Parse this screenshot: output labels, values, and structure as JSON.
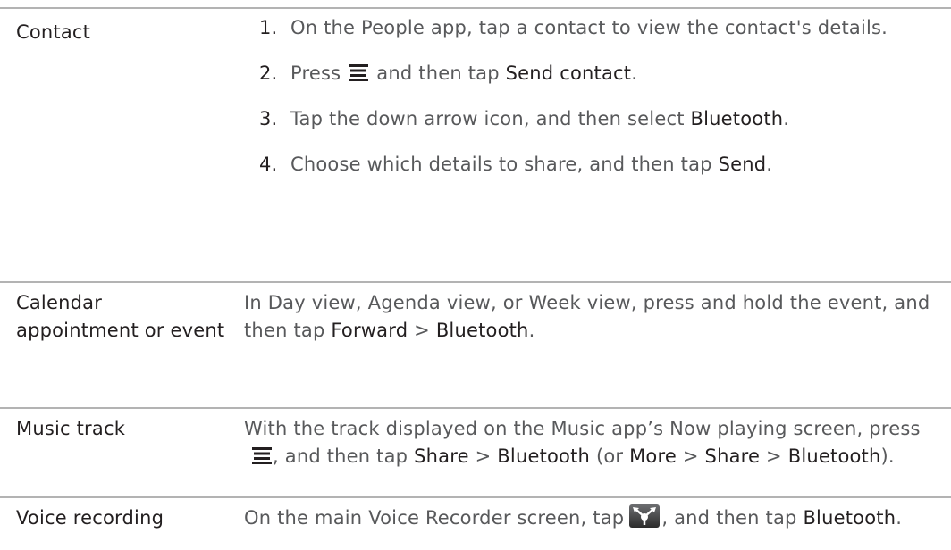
{
  "rows": [
    {
      "label": "Contact",
      "steps": [
        {
          "num": "1.",
          "text": "On the People app, tap a contact to view the contact's details."
        },
        {
          "num": "2.",
          "pre": "Press",
          "mid": "and then tap",
          "em": "Send contact",
          "post": "."
        },
        {
          "num": "3.",
          "pre": "Tap the down arrow icon, and then select",
          "em": "Bluetooth",
          "post": "."
        },
        {
          "num": "4.",
          "pre": "Choose which details to share, and then tap",
          "em": "Send",
          "post": "."
        }
      ]
    },
    {
      "label": "Calendar appointment or event",
      "text_pre": "In Day view, Agenda view, or Week view, press and hold the event, and then tap",
      "em1": "Forward",
      "sep": ">",
      "em2": "Bluetooth",
      "post": "."
    },
    {
      "label": "Music track",
      "text_pre": "With the track displayed on the Music app’s Now playing screen, press",
      "text_mid": ", and then tap",
      "em1": "Share",
      "sep1": ">",
      "em2": "Bluetooth",
      "paren_open": "(or",
      "em3": "More",
      "sep2": ">",
      "em4": "Share",
      "sep3": ">",
      "em5": "Bluetooth",
      "post": ")."
    },
    {
      "label": "Voice recording",
      "text_pre": "On the main Voice Recorder screen, tap",
      "text_mid": ", and then tap",
      "em1": "Bluetooth",
      "post": "."
    }
  ],
  "icons": {
    "menu": "menu-icon",
    "voice_share": "share-icon"
  },
  "colors": {
    "text": "#58595b",
    "emphasis": "#231f20",
    "rule": "#b3b3b3"
  }
}
